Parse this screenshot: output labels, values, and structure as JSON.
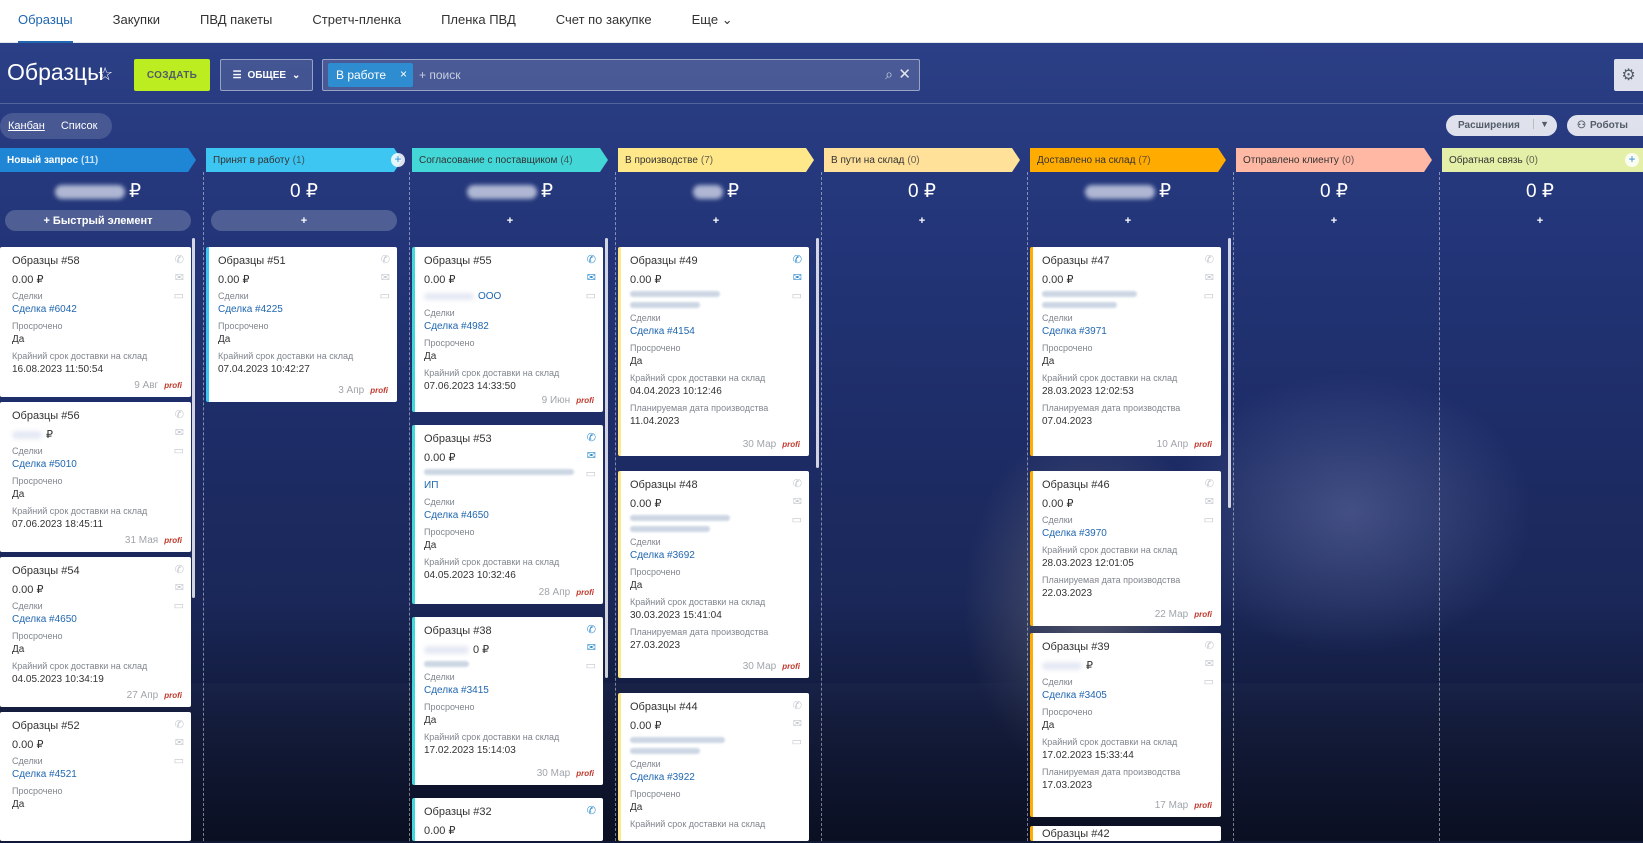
{
  "topnav": {
    "items": [
      "Образцы",
      "Закупки",
      "ПВД пакеты",
      "Стретч-пленка",
      "Пленка ПВД",
      "Счет по закупке",
      "Еще ⌄"
    ]
  },
  "toolbar": {
    "title": "Образцы",
    "create": "СОЗДАТЬ",
    "filter": "ОБЩЕЕ",
    "tag": "В работе",
    "search_placeholder": "+ поиск"
  },
  "views": {
    "kanban": "Канбан",
    "list": "Список"
  },
  "buttons": {
    "extensions": "Расширения",
    "robots": "Роботы",
    "quick": "+ Быстрый элемент",
    "plus": "+"
  },
  "colors": {
    "c1": "#1f86d6",
    "c2": "#3ec6f2",
    "c3": "#44d7d7",
    "c4": "#ffe88a",
    "c5": "#ffe19a",
    "c6": "#ffab00",
    "c7": "#ffb8a3",
    "c8": "#e4f0a8"
  },
  "columns": [
    {
      "name": "Новый запрос",
      "count": "(11)",
      "sum": "₽"
    },
    {
      "name": "Принят в работу",
      "count": "(1)",
      "sum": "0 ₽"
    },
    {
      "name": "Согласование с поставщиком",
      "count": "(4)",
      "sum": "₽"
    },
    {
      "name": "В производстве",
      "count": "(7)",
      "sum": "₽"
    },
    {
      "name": "В пути на склад",
      "count": "(0)",
      "sum": "0 ₽"
    },
    {
      "name": "Доставлено на склад",
      "count": "(7)",
      "sum": "₽"
    },
    {
      "name": "Отправлено клиенту",
      "count": "(0)",
      "sum": "0 ₽"
    },
    {
      "name": "Обратная связь",
      "count": "(0)",
      "sum": "0 ₽"
    }
  ],
  "labels": {
    "deals": "Сделки",
    "overdue": "Просрочено",
    "deadline": "Крайний срок доставки на склад",
    "planned": "Планируемая дата производства",
    "yes": "Да",
    "zero": "0.00 ₽",
    "rub": "₽",
    "ooo": "ООО",
    "ip": "ИП",
    "zero_rub": "0 ₽",
    "brand": "profi"
  },
  "cards": {
    "c58": {
      "title": "Образцы #58",
      "deal": "Сделка #6042",
      "date": "16.08.2023 11:50:54",
      "foot": "9 Авг"
    },
    "c56": {
      "title": "Образцы #56",
      "deal": "Сделка #5010",
      "date": "07.06.2023 18:45:11",
      "foot": "31 Мая"
    },
    "c54": {
      "title": "Образцы #54",
      "deal": "Сделка #4650",
      "date": "04.05.2023 10:34:19",
      "foot": "27 Апр"
    },
    "c52": {
      "title": "Образцы #52",
      "deal": "Сделка #4521"
    },
    "c51": {
      "title": "Образцы #51",
      "deal": "Сделка #4225",
      "date": "07.04.2023 10:42:27",
      "foot": "3 Апр"
    },
    "c55": {
      "title": "Образцы #55",
      "deal": "Сделка #4982",
      "date": "07.06.2023 14:33:50",
      "foot": "9 Июн"
    },
    "c53": {
      "title": "Образцы #53",
      "deal": "Сделка #4650",
      "date": "04.05.2023 10:32:46",
      "foot": "28 Апр"
    },
    "c38": {
      "title": "Образцы #38",
      "deal": "Сделка #3415",
      "date": "17.02.2023 15:14:03",
      "foot": "30 Мар"
    },
    "c32": {
      "title": "Образцы #32"
    },
    "c49": {
      "title": "Образцы #49",
      "deal": "Сделка #4154",
      "date": "04.04.2023 10:12:46",
      "plan": "11.04.2023",
      "foot": "30 Мар"
    },
    "c48": {
      "title": "Образцы #48",
      "deal": "Сделка #3692",
      "date": "30.03.2023 15:41:04",
      "plan": "27.03.2023",
      "foot": "30 Мар"
    },
    "c44": {
      "title": "Образцы #44",
      "deal": "Сделка #3922"
    },
    "c47": {
      "title": "Образцы #47",
      "deal": "Сделка #3971",
      "date": "28.03.2023 12:02:53",
      "plan": "07.04.2023",
      "foot": "10 Апр"
    },
    "c46": {
      "title": "Образцы #46",
      "deal": "Сделка #3970",
      "date": "28.03.2023 12:01:05",
      "plan": "22.03.2023",
      "foot": "22 Мар"
    },
    "c39": {
      "title": "Образцы #39",
      "deal": "Сделка #3405",
      "date": "17.02.2023 15:33:44",
      "plan": "17.03.2023",
      "foot": "17 Мар"
    },
    "c42": {
      "title": "Образцы #42"
    }
  }
}
